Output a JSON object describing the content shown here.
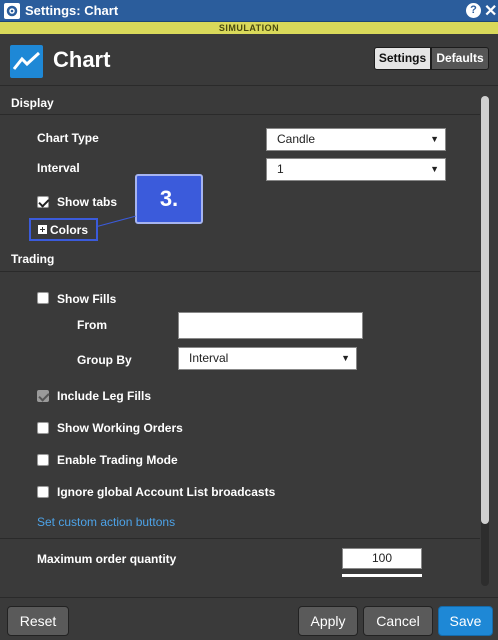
{
  "window": {
    "title": "Settings: Chart",
    "help": "?",
    "close": "✕"
  },
  "banner": "SIMULATION",
  "header": {
    "title": "Chart",
    "tabs": [
      "Settings",
      "Defaults"
    ]
  },
  "display": {
    "section": "Display",
    "chart_type": {
      "label": "Chart Type",
      "value": "Candle"
    },
    "interval": {
      "label": "Interval",
      "value": "1"
    },
    "show_tabs": {
      "label": "Show tabs",
      "checked": true
    },
    "colors": {
      "label": "Colors"
    }
  },
  "callout": "3.",
  "trading": {
    "section": "Trading",
    "show_fills": {
      "label": "Show Fills",
      "checked": false
    },
    "from": {
      "label": "From",
      "value": ""
    },
    "group_by": {
      "label": "Group By",
      "value": "Interval"
    },
    "include_leg_fills": {
      "label": "Include Leg Fills",
      "checked": true,
      "disabled": true
    },
    "show_working_orders": {
      "label": "Show Working Orders",
      "checked": false
    },
    "enable_trading_mode": {
      "label": "Enable Trading Mode",
      "checked": false
    },
    "ignore_broadcasts": {
      "label": "Ignore global Account List broadcasts",
      "checked": false
    },
    "custom_action_link": "Set custom action buttons",
    "max_order_qty": {
      "label": "Maximum order quantity",
      "value": "100"
    }
  },
  "footer": {
    "reset": "Reset",
    "apply": "Apply",
    "cancel": "Cancel",
    "save": "Save"
  },
  "colors": {
    "accent": "#1e88d6",
    "titlebar": "#2b5d9c",
    "banner": "#d9d95a",
    "callout": "#3b5bdb",
    "link": "#4da3e8"
  }
}
